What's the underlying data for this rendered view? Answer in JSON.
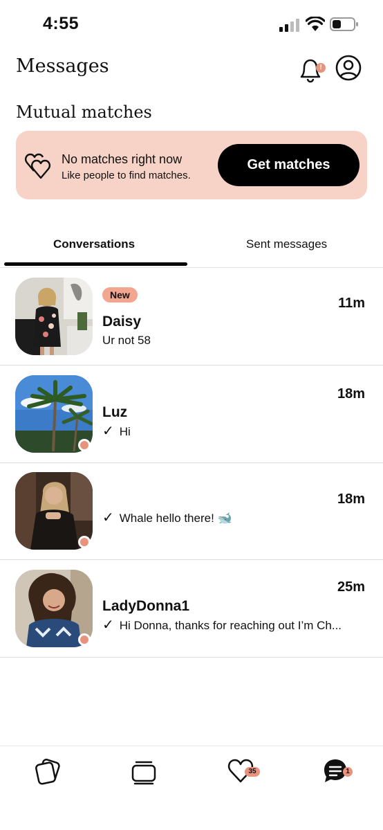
{
  "status_bar": {
    "time": "4:55"
  },
  "header": {
    "title": "Messages",
    "notification_badge": "!"
  },
  "mutual_matches": {
    "heading": "Mutual matches",
    "banner_title": "No matches right now",
    "banner_subtitle": "Like people to find matches.",
    "cta_label": "Get matches"
  },
  "tabs": {
    "conversations": "Conversations",
    "sent": "Sent messages",
    "active": "conversations"
  },
  "conversations": [
    {
      "badge": "New",
      "name": "Daisy",
      "message": "Ur not 58",
      "time": "11m",
      "sent_check": false,
      "online": false
    },
    {
      "badge": "",
      "name": "Luz",
      "message": "Hi",
      "time": "18m",
      "sent_check": true,
      "online": true
    },
    {
      "badge": "",
      "name": "",
      "message": "Whale hello there! 🐋",
      "time": "18m",
      "sent_check": true,
      "online": true
    },
    {
      "badge": "",
      "name": "LadyDonna1",
      "message": "Hi Donna, thanks for reaching out I’m Ch...",
      "time": "25m",
      "sent_check": true,
      "online": true
    }
  ],
  "bottom_nav": {
    "likes_count": "35",
    "messages_count": "1"
  },
  "colors": {
    "accent": "#e8937e",
    "banner_bg": "#f7d2c6",
    "new_badge": "#f2a58f"
  }
}
